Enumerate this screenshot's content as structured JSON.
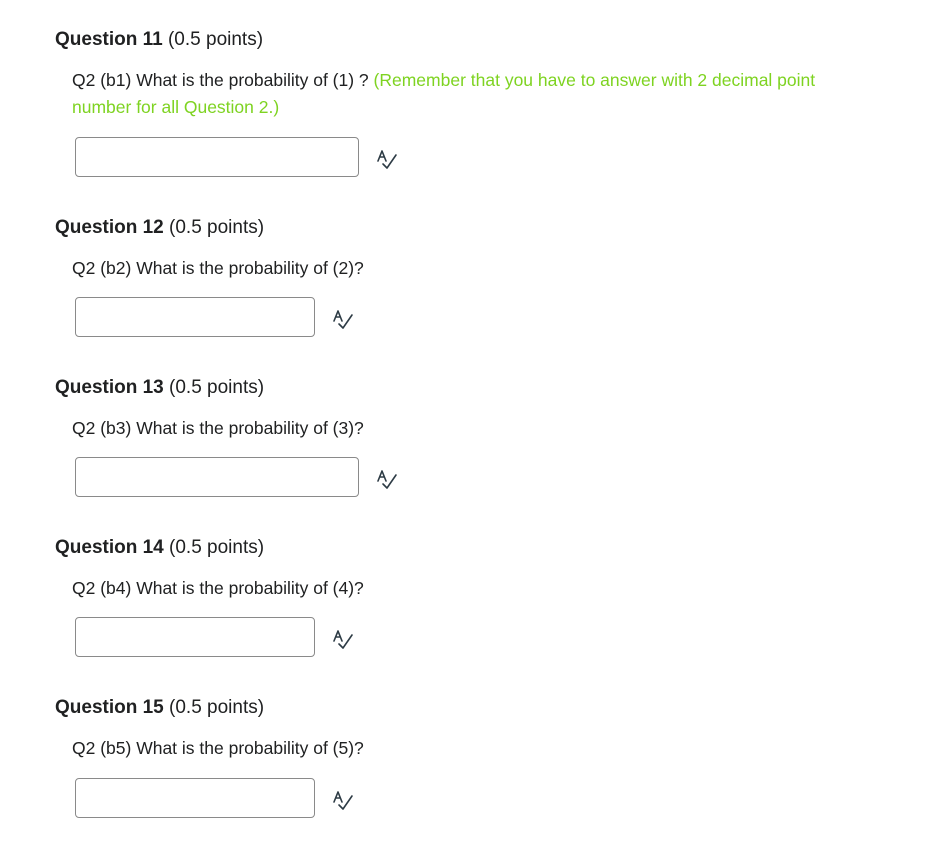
{
  "questions": [
    {
      "name": "Question 11",
      "points": "(0.5 points)",
      "text": "Q2 (b1) What is the probability of (1) ? ",
      "hint": "(Remember that you have to answer with 2 decimal point number for all Question 2.)",
      "answer_value": "",
      "icon": "spellcheck-icon"
    },
    {
      "name": "Question 12",
      "points": "(0.5 points)",
      "text": "Q2 (b2) What is the probability of (2)?",
      "answer_value": "",
      "icon": "spellcheck-icon"
    },
    {
      "name": "Question 13",
      "points": "(0.5 points)",
      "text": "Q2 (b3) What is the probability of (3)?",
      "answer_value": "",
      "icon": "spellcheck-icon"
    },
    {
      "name": "Question 14",
      "points": "(0.5 points)",
      "text": "Q2 (b4) What is the probability of (4)?",
      "answer_value": "",
      "icon": "spellcheck-icon"
    },
    {
      "name": "Question 15",
      "points": "(0.5 points)",
      "text": "Q2 (b5) What is the probability of (5)?",
      "answer_value": "",
      "icon": "spellcheck-icon"
    }
  ],
  "colors": {
    "hint_text": "#7ed321",
    "body_text": "#202122",
    "input_border": "#8a8a8a"
  }
}
